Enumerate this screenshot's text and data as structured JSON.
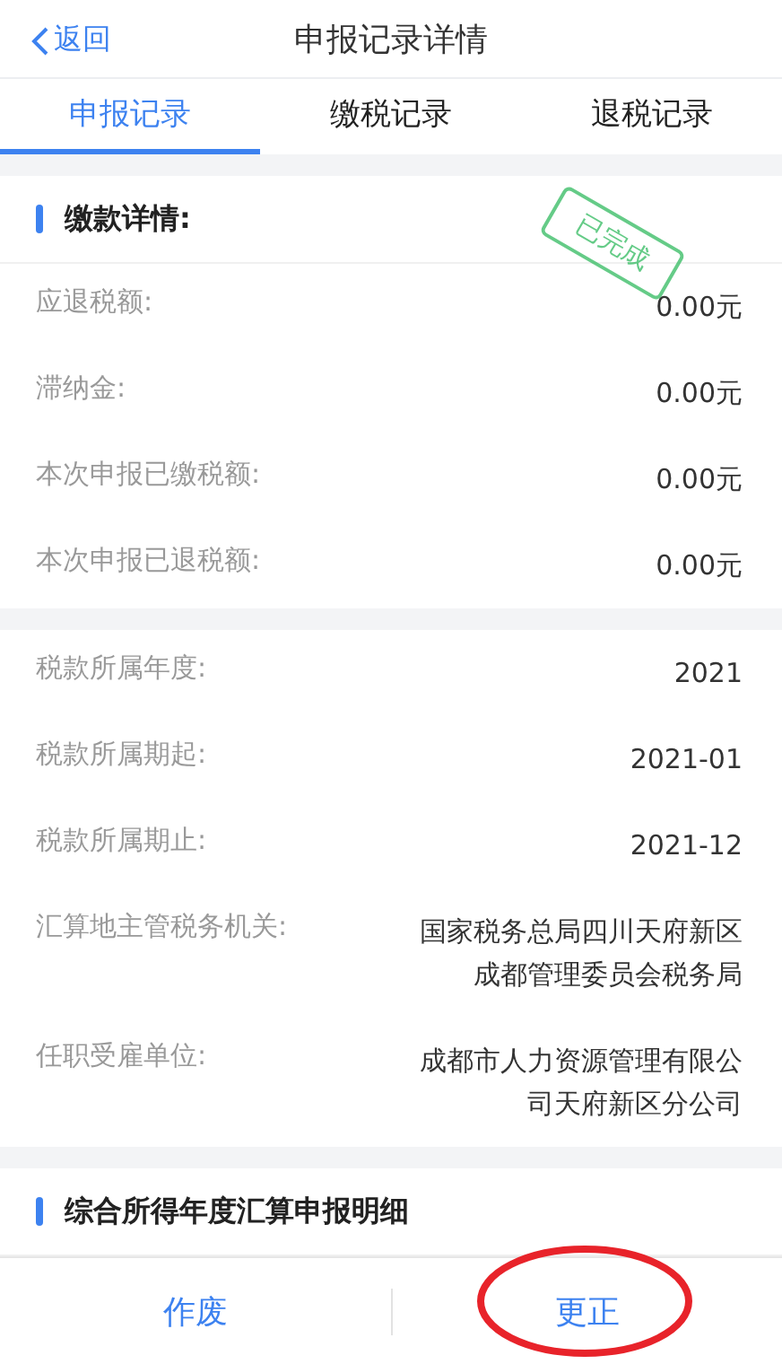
{
  "header": {
    "back": "返回",
    "title": "申报记录详情"
  },
  "tabs": [
    {
      "label": "申报记录",
      "selected": true
    },
    {
      "label": "缴税记录",
      "selected": false
    },
    {
      "label": "退税记录",
      "selected": false
    }
  ],
  "payment": {
    "title": "缴款详情:",
    "stamp": "已完成",
    "rows": [
      {
        "label": "应退税额:",
        "value": "0.00元"
      },
      {
        "label": "滞纳金:",
        "value": "0.00元"
      },
      {
        "label": "本次申报已缴税额:",
        "value": "0.00元"
      },
      {
        "label": "本次申报已退税额:",
        "value": "0.00元"
      }
    ]
  },
  "info": {
    "rows": [
      {
        "label": "税款所属年度:",
        "value": "2021"
      },
      {
        "label": "税款所属期起:",
        "value": "2021-01"
      },
      {
        "label": "税款所属期止:",
        "value": "2021-12"
      },
      {
        "label": "汇算地主管税务机关:",
        "value": "国家税务总局四川天府新区成都管理委员会税务局"
      },
      {
        "label": "任职受雇单位:",
        "value": "成都市人力资源管理有限公司天府新区分公司"
      }
    ]
  },
  "detail": {
    "title": "综合所得年度汇算申报明细"
  },
  "footer": {
    "buttons": [
      {
        "label": "作废",
        "highlighted": false
      },
      {
        "label": "更正",
        "highlighted": true
      }
    ]
  }
}
